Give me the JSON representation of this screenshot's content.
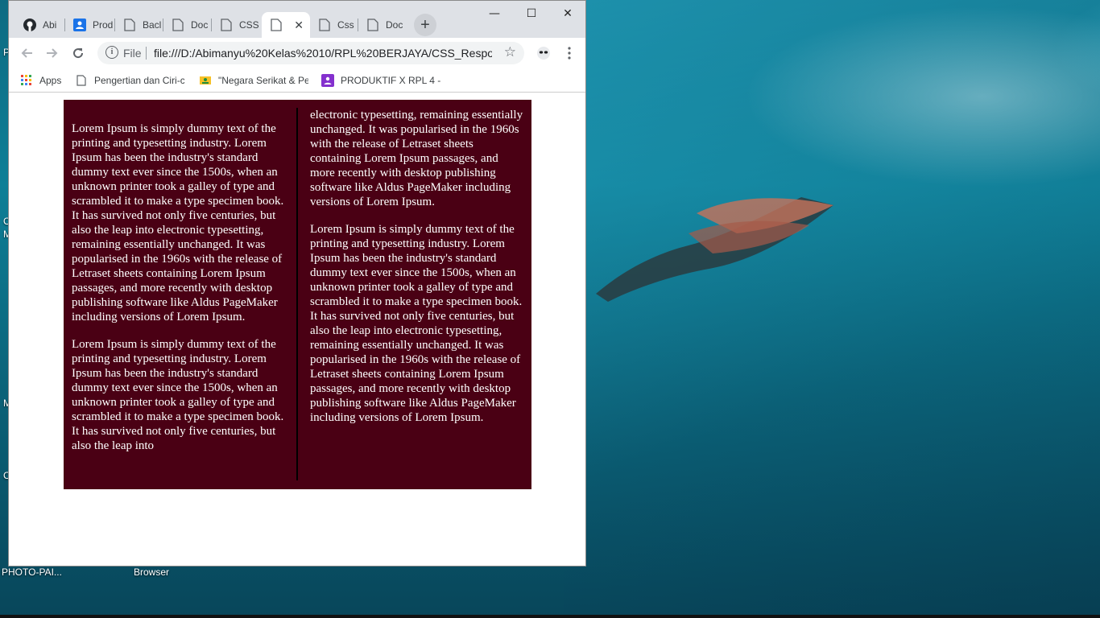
{
  "desktop": {
    "icon_labels": [
      "PHOTO-PAI...",
      "Browser"
    ],
    "edge_marks": [
      "P",
      "C",
      "M",
      "M",
      "C"
    ]
  },
  "browser": {
    "tabs": [
      {
        "label": "Abi",
        "icon": "github-icon",
        "active": false
      },
      {
        "label": "Prod",
        "icon": "profile-icon",
        "active": false
      },
      {
        "label": "Bacl",
        "icon": "page-icon",
        "active": false
      },
      {
        "label": "Doc",
        "icon": "page-icon",
        "active": false
      },
      {
        "label": "CSS",
        "icon": "page-icon",
        "active": false
      },
      {
        "label": "",
        "icon": "page-icon",
        "active": true
      },
      {
        "label": "Css",
        "icon": "page-icon",
        "active": false
      },
      {
        "label": "Doc",
        "icon": "page-icon",
        "active": false
      }
    ],
    "new_tab": "+",
    "window_controls": {
      "minimize": "—",
      "maximize": "☐",
      "close": "✕"
    },
    "address": {
      "scheme": "File",
      "url": "file:///D:/Abimanyu%20Kelas%2010/RPL%20BERJAYA/CSS_Respon..."
    },
    "bookmarks": [
      {
        "label": "Apps",
        "icon": "apps-grid-icon"
      },
      {
        "label": "Pengertian dan Ciri-ci",
        "icon": "page-icon"
      },
      {
        "label": "\"Negara Serikat & Pe",
        "icon": "classroom-icon"
      },
      {
        "label": "PRODUKTIF X RPL 4 -",
        "icon": "purple-icon"
      }
    ]
  },
  "page": {
    "left_column": [
      "Lorem Ipsum is simply dummy text of the printing and typesetting industry. Lorem Ipsum has been the industry's standard dummy text ever since the 1500s, when an unknown printer took a galley of type and scrambled it to make a type specimen book. It has survived not only five centuries, but also the leap into electronic typesetting, remaining essentially unchanged. It was popularised in the 1960s with the release of Letraset sheets containing Lorem Ipsum passages, and more recently with desktop publishing software like Aldus PageMaker including versions of Lorem Ipsum.",
      "Lorem Ipsum is simply dummy text of the printing and typesetting industry. Lorem Ipsum has been the industry's standard dummy text ever since the 1500s, when an unknown printer took a galley of type and scrambled it to make a type specimen book. It has survived not only five centuries, but also the leap into"
    ],
    "right_column": [
      "electronic typesetting, remaining essentially unchanged. It was popularised in the 1960s with the release of Letraset sheets containing Lorem Ipsum passages, and more recently with desktop publishing software like Aldus PageMaker including versions of Lorem Ipsum.",
      "Lorem Ipsum is simply dummy text of the printing and typesetting industry. Lorem Ipsum has been the industry's standard dummy text ever since the 1500s, when an unknown printer took a galley of type and scrambled it to make a type specimen book. It has survived not only five centuries, but also the leap into electronic typesetting, remaining essentially unchanged. It was popularised in the 1960s with the release of Letraset sheets containing Lorem Ipsum passages, and more recently with desktop publishing software like Aldus PageMaker including versions of Lorem Ipsum."
    ]
  },
  "colors": {
    "article_background": "#4a0014",
    "article_text": "#ffffff",
    "column_rule": "#000000"
  }
}
